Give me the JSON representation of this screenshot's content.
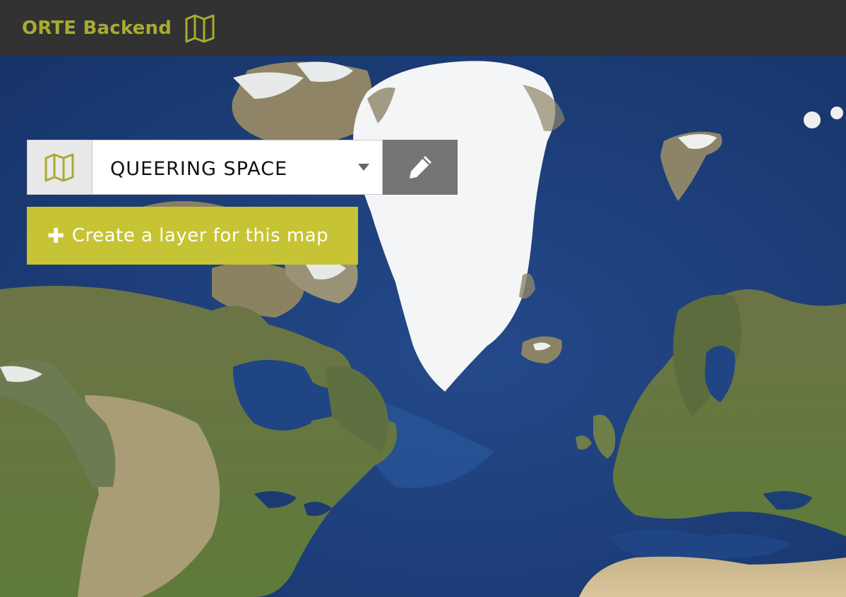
{
  "header": {
    "app_title": "ORTE Backend",
    "icon": "folded-map-icon",
    "accent_color": "#a9ab2f",
    "background_color": "#323232"
  },
  "map_selector": {
    "icon": "folded-map-icon",
    "selected_map": "QUEERING SPACE",
    "dropdown_icon": "chevron-down-icon",
    "edit_icon": "pencil-icon"
  },
  "create_layer": {
    "icon": "plus-icon",
    "plus_glyph": "✚",
    "label": "Create a layer for this map",
    "color": "#c6c434"
  },
  "basemap": {
    "style": "satellite imagery"
  }
}
